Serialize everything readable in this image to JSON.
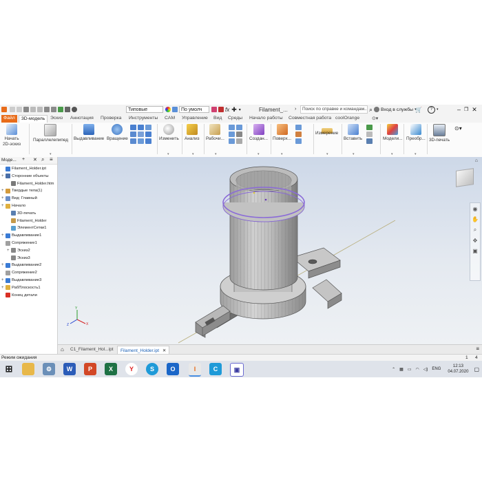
{
  "app": {
    "window_title": "Filament_...",
    "help_search_placeholder": "Поиск по справке и командам...",
    "signin": "Вход в службы",
    "appearance_dropdown": "Типовые",
    "material_dropdown": "По умолч"
  },
  "tabs": [
    "Файл",
    "3D-модель",
    "Эскиз",
    "Аннотация",
    "Проверка",
    "Инструменты",
    "CAM",
    "Управление",
    "Вид",
    "Среды",
    "Начало работы",
    "Совместная работа",
    "coolOrange"
  ],
  "ribbon": {
    "start_sketch": "Начать\n2D-эскиз",
    "box": "Параллелепипед",
    "extrude": "Выдавливание",
    "revolve": "Вращение",
    "modify": "Изменить",
    "analyze": "Анализ",
    "work_features": "Рабочи...",
    "create": "Создан...",
    "surface": "Поверх...",
    "measure": "Измерение",
    "insert": "Вставить",
    "model": "Модели...",
    "convert": "Преобр...",
    "print3d": "3D-печать"
  },
  "browser": {
    "title": "Моде...",
    "items": [
      {
        "label": "Filament_Holder.ipt",
        "icon": "part-icon",
        "color": "#3a7bd5"
      },
      {
        "label": "Сторонние объекты",
        "icon": "relations-icon",
        "color": "#4a6fa8"
      },
      {
        "label": "Filament_Holder.htm",
        "icon": "document-icon",
        "color": "#7a7a7a"
      },
      {
        "label": "Твердые тела(1)",
        "icon": "solid-bodies-icon",
        "color": "#d49b3c"
      },
      {
        "label": "Вид: Главный",
        "icon": "view-icon",
        "color": "#6b8fc9"
      },
      {
        "label": "Начало",
        "icon": "origin-folder-icon",
        "color": "#e0b040"
      },
      {
        "label": "3D-печать",
        "icon": "print3d-icon",
        "color": "#5a7fb0"
      },
      {
        "label": "Filament_Holder",
        "icon": "part-icon",
        "color": "#c59a4a"
      },
      {
        "label": "ЭлементСетки1",
        "icon": "mesh-feature-icon",
        "color": "#5aa0d0"
      },
      {
        "label": "Выдавливание1",
        "icon": "extrude-icon",
        "color": "#3a7bd5"
      },
      {
        "label": "Сопряжение1",
        "icon": "fillet-icon",
        "color": "#a0a0a0"
      },
      {
        "label": "Эскиз2",
        "icon": "sketch-icon",
        "color": "#888888"
      },
      {
        "label": "Эскиз3",
        "icon": "sketch-icon",
        "color": "#888888"
      },
      {
        "label": "Выдавливание2",
        "icon": "extrude-icon",
        "color": "#3a7bd5"
      },
      {
        "label": "Сопряжение2",
        "icon": "fillet-icon",
        "color": "#a0a0a0"
      },
      {
        "label": "Выдавливание3",
        "icon": "extrude-icon",
        "color": "#3a7bd5"
      },
      {
        "label": "РабПлоскость1",
        "icon": "work-plane-icon",
        "color": "#e0b040"
      },
      {
        "label": "Конец детали",
        "icon": "end-of-part-icon",
        "color": "#d93025"
      }
    ]
  },
  "document_tabs": [
    "C1_Filament_Hol...ipt",
    "Filament_Holder.ipt"
  ],
  "status": {
    "text": "Режим ожидания",
    "count_a": "1",
    "count_b": "4"
  },
  "taskbar": {
    "lang": "ENG",
    "time": "12:13",
    "date": "04.07.2020"
  }
}
